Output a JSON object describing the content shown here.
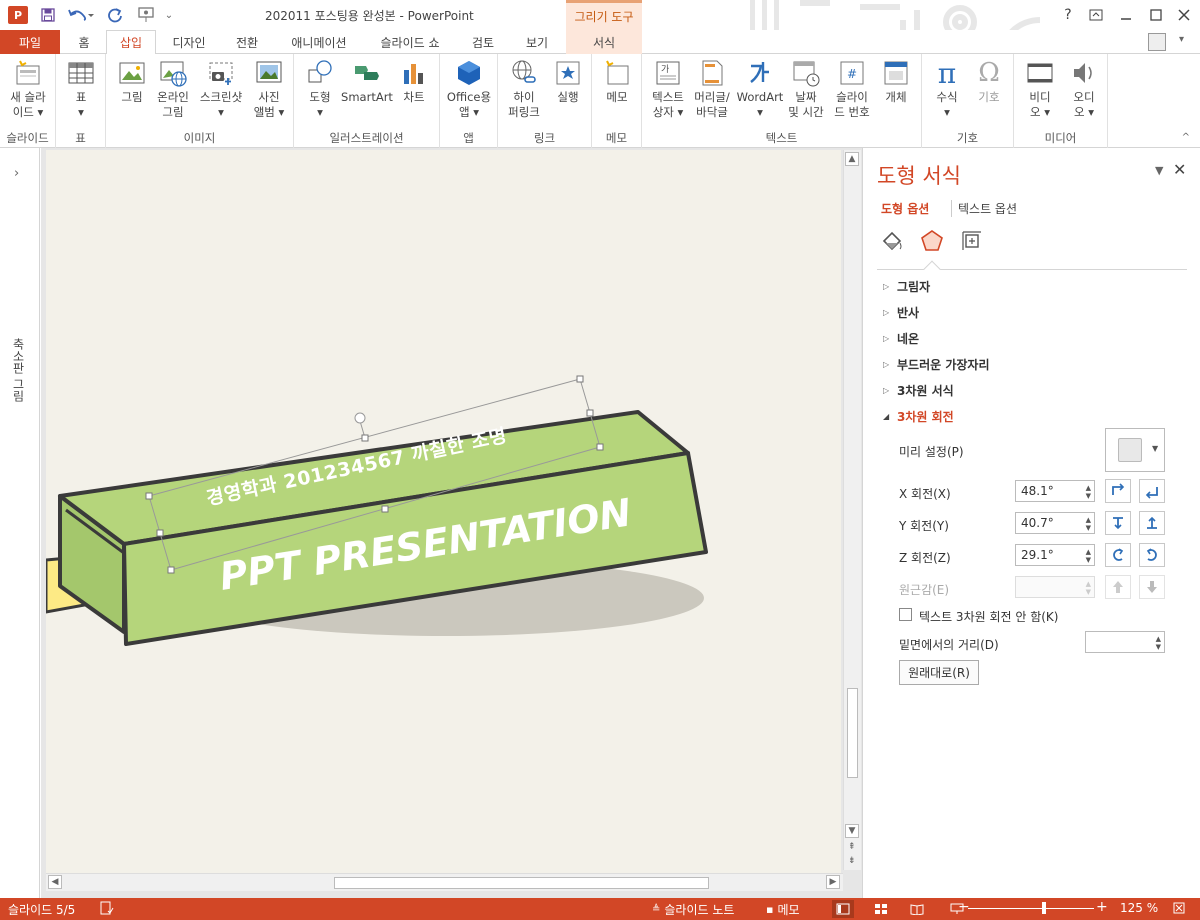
{
  "app": {
    "title": "202011 포스팅용 완성본 - PowerPoint",
    "app_icon": "P",
    "contextual_tab_group": "그리기 도구",
    "help": "?"
  },
  "tabs": [
    "파일",
    "홈",
    "삽입",
    "디자인",
    "전환",
    "애니메이션",
    "슬라이드 쇼",
    "검토",
    "보기",
    "서식"
  ],
  "active_tab": "삽입",
  "ribbon": {
    "groups": [
      {
        "label": "슬라이드",
        "buttons": [
          {
            "label": "새 슬라\n이드 ▾",
            "icon": "new-slide-icon"
          }
        ]
      },
      {
        "label": "표",
        "buttons": [
          {
            "label": "표\n▾",
            "icon": "table-icon"
          }
        ]
      },
      {
        "label": "이미지",
        "buttons": [
          {
            "label": "그림",
            "icon": "picture-icon"
          },
          {
            "label": "온라인\n그림",
            "icon": "online-picture-icon"
          },
          {
            "label": "스크린샷\n▾",
            "icon": "screenshot-icon"
          },
          {
            "label": "사진\n앨범 ▾",
            "icon": "photo-album-icon"
          }
        ]
      },
      {
        "label": "일러스트레이션",
        "buttons": [
          {
            "label": "도형\n▾",
            "icon": "shapes-icon"
          },
          {
            "label": "SmartArt",
            "icon": "smartart-icon"
          },
          {
            "label": "차트",
            "icon": "chart-icon"
          }
        ]
      },
      {
        "label": "앱",
        "buttons": [
          {
            "label": "Office용\n앱 ▾",
            "icon": "office-apps-icon"
          }
        ]
      },
      {
        "label": "링크",
        "buttons": [
          {
            "label": "하이\n퍼링크",
            "icon": "hyperlink-icon"
          },
          {
            "label": "실행",
            "icon": "action-icon"
          }
        ]
      },
      {
        "label": "메모",
        "buttons": [
          {
            "label": "메모",
            "icon": "comment-icon"
          }
        ]
      },
      {
        "label": "텍스트",
        "buttons": [
          {
            "label": "텍스트\n상자 ▾",
            "icon": "text-box-icon"
          },
          {
            "label": "머리글/\n바닥글",
            "icon": "header-footer-icon"
          },
          {
            "label": "WordArt\n▾",
            "icon": "wordart-icon"
          },
          {
            "label": "날짜\n및 시간",
            "icon": "date-time-icon"
          },
          {
            "label": "슬라이\n드 번호",
            "icon": "slide-number-icon"
          },
          {
            "label": "개체",
            "icon": "object-icon"
          }
        ]
      },
      {
        "label": "기호",
        "buttons": [
          {
            "label": "수식\n▾",
            "icon": "equation-icon"
          },
          {
            "label": "기호",
            "icon": "symbol-icon"
          }
        ]
      },
      {
        "label": "미디어",
        "buttons": [
          {
            "label": "비디\n오 ▾",
            "icon": "video-icon"
          },
          {
            "label": "오디\n오 ▾",
            "icon": "audio-icon"
          }
        ]
      }
    ]
  },
  "thumbnail_pane": {
    "label": "축소판 그림",
    "expand": "›"
  },
  "slide": {
    "subtitle": "경영학과 201234567 까칠한 조명",
    "title": "PPT PRESENTATION",
    "colors": {
      "box": "#b5d57b",
      "box_dark": "#a4c76c",
      "tab": "#fdea85",
      "background": "#f3f1e9",
      "shadow": "#cbc8be"
    }
  },
  "format_pane": {
    "title": "도형 서식",
    "tabs": [
      "도형 옵션",
      "텍스트 옵션"
    ],
    "icons": [
      "fill-line-icon",
      "effects-icon",
      "size-properties-icon"
    ],
    "sections": [
      "그림자",
      "반사",
      "네온",
      "부드러운 가장자리",
      "3차원 서식",
      "3차원 회전"
    ],
    "open_section": "3차원 회전",
    "presets_label": "미리 설정(P)",
    "x_label": "X 회전(X)",
    "x_value": "48.1°",
    "y_label": "Y 회전(Y)",
    "y_value": "40.7°",
    "z_label": "Z 회전(Z)",
    "z_value": "29.1°",
    "perspective_label": "원근감(E)",
    "keep_flat_label": "텍스트 3차원 회전 안 함(K)",
    "distance_label": "밑면에서의 거리(D)",
    "reset_label": "원래대로(R)"
  },
  "status": {
    "slide_of": "슬라이드 5/5",
    "notes": "슬라이드 노트",
    "comments": "메모",
    "zoom": "125 %"
  },
  "theme": {
    "accent": "#d24726",
    "accent_light": "#fde7db"
  }
}
